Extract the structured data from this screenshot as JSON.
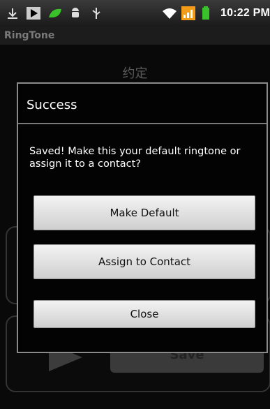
{
  "status_bar": {
    "time": "10:22 PM",
    "icons": [
      "download-icon",
      "media-play-icon",
      "leaf-icon",
      "android-icon",
      "usb-icon",
      "wifi-icon",
      "signal-icon",
      "battery-icon"
    ]
  },
  "app": {
    "title": "RingTone",
    "song_title": "约定",
    "save_label": "Save"
  },
  "dialog": {
    "title": "Success",
    "message": "Saved! Make this your default ringtone or assign it to a contact?",
    "buttons": {
      "make_default": "Make Default",
      "assign_contact": "Assign to Contact",
      "close": "Close"
    }
  },
  "colors": {
    "status_green": "#39c22a",
    "signal_orange": "#f39c1a",
    "dialog_border": "#8a8a8a"
  }
}
